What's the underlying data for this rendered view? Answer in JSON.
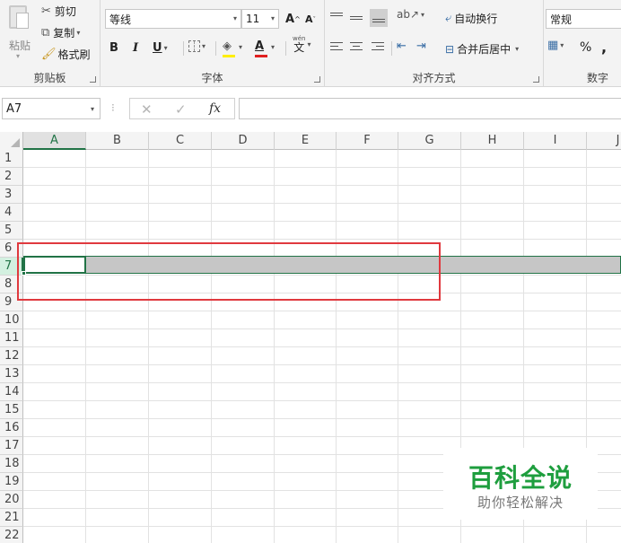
{
  "ribbon": {
    "clipboard": {
      "paste_label": "粘贴",
      "cut_label": "剪切",
      "copy_label": "复制",
      "format_painter_label": "格式刷",
      "group_label": "剪贴板"
    },
    "font": {
      "font_name": "等线",
      "font_size": "11",
      "grow_label": "A",
      "shrink_label": "A",
      "bold_label": "B",
      "italic_label": "I",
      "underline_label": "U",
      "font_color_label": "A",
      "phonetic_label": "文",
      "phonetic_sup": "wén",
      "group_label": "字体"
    },
    "alignment": {
      "wrap_text_label": "自动换行",
      "merge_center_label": "合并后居中",
      "group_label": "对齐方式"
    },
    "number": {
      "format_value": "常规",
      "percent_label": "%",
      "comma_label": ",",
      "group_label": "数字"
    }
  },
  "formula_bar": {
    "name_box_value": "A7",
    "cancel_symbol": "✕",
    "enter_symbol": "✓",
    "fx_label": "fx",
    "formula_value": ""
  },
  "grid": {
    "columns": [
      "A",
      "B",
      "C",
      "D",
      "E",
      "F",
      "G",
      "H",
      "I",
      "J"
    ],
    "rows": [
      "1",
      "2",
      "3",
      "4",
      "5",
      "6",
      "7",
      "8",
      "9",
      "10",
      "11",
      "12",
      "13",
      "14",
      "15",
      "16",
      "17",
      "18",
      "19",
      "20",
      "21",
      "22"
    ],
    "active_cell": "A7",
    "selected_row": "7"
  },
  "watermark": {
    "title": "百科全说",
    "subtitle": "助你轻松解决"
  },
  "colors": {
    "excel_green": "#217346",
    "annotation_red": "#e0393e",
    "selection_gray": "#c6c6c6",
    "watermark_green": "#1e9e3e"
  }
}
